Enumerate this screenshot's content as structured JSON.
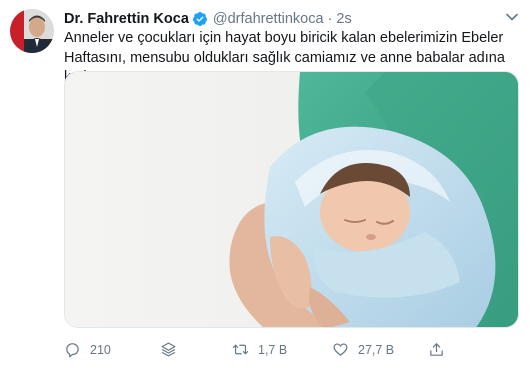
{
  "tweet": {
    "author_name": "Dr. Fahrettin Koca",
    "handle": "@drfahrettinkoca",
    "separator": "·",
    "time": "2s",
    "text_line1": "Anneler ve çocukları için hayat boyu biricik kalan ebelerimizin Ebeler",
    "text_line2": "Haftasını, mensubu oldukları sağlık camiamız ve anne babalar adına kutlarım.",
    "icons": {
      "verified": "verified-badge-icon",
      "more": "chevron-down-icon"
    },
    "actions": {
      "reply_count": "210",
      "retweet_count": "1,7 B",
      "like_count": "27,7 B"
    }
  },
  "colors": {
    "accent": "#1da1f2",
    "secondary_text": "#657786",
    "primary_text": "#14171a"
  }
}
